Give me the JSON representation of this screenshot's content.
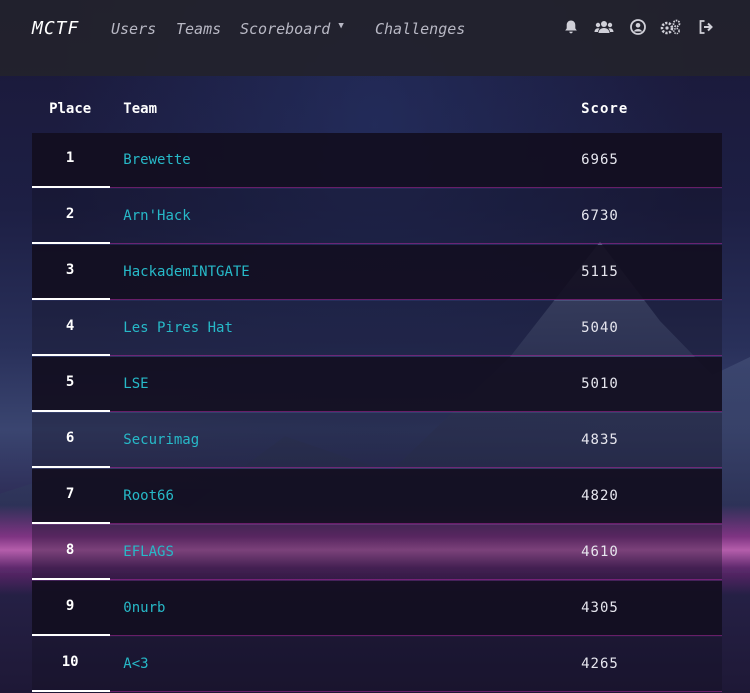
{
  "nav": {
    "brand": "MCTF",
    "items": [
      {
        "label": "Users"
      },
      {
        "label": "Teams"
      },
      {
        "label": "Scoreboard"
      },
      {
        "label": "Challenges"
      }
    ],
    "icons": [
      "bell-icon",
      "users-icon",
      "user-circle-icon",
      "settings-icon",
      "logout-icon"
    ]
  },
  "scoreboard": {
    "headers": {
      "place": "Place",
      "team": "Team",
      "score": "Score"
    },
    "rows": [
      {
        "place": "1",
        "team": "Brewette",
        "score": "6965"
      },
      {
        "place": "2",
        "team": "Arn'Hack",
        "score": "6730"
      },
      {
        "place": "3",
        "team": "HackademINTGATE",
        "score": "5115"
      },
      {
        "place": "4",
        "team": "Les Pires Hat",
        "score": "5040"
      },
      {
        "place": "5",
        "team": "LSE",
        "score": "5010"
      },
      {
        "place": "6",
        "team": "Securimag",
        "score": "4835"
      },
      {
        "place": "7",
        "team": "Root66",
        "score": "4820"
      },
      {
        "place": "8",
        "team": "EFLAGS",
        "score": "4610"
      },
      {
        "place": "9",
        "team": "0nurb",
        "score": "4305"
      },
      {
        "place": "10",
        "team": "A<3",
        "score": "4265"
      }
    ]
  }
}
